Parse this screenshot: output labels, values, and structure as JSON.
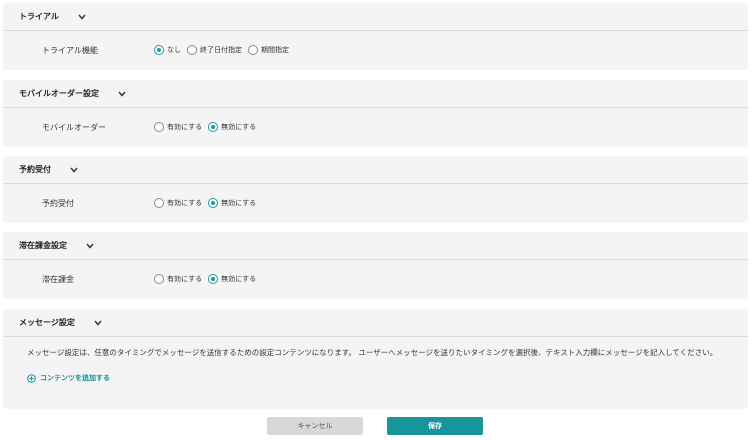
{
  "sections": [
    {
      "title": "トライアル",
      "field_label": "トライアル機能",
      "options": [
        {
          "label": "なし",
          "selected": true
        },
        {
          "label": "終了日付指定",
          "selected": false
        },
        {
          "label": "期間指定",
          "selected": false
        }
      ]
    },
    {
      "title": "モバイルオーダー設定",
      "field_label": "モバイルオーダー",
      "options": [
        {
          "label": "有効にする",
          "selected": false
        },
        {
          "label": "無効にする",
          "selected": true
        }
      ]
    },
    {
      "title": "予約受付",
      "field_label": "予約受付",
      "options": [
        {
          "label": "有効にする",
          "selected": false
        },
        {
          "label": "無効にする",
          "selected": true
        }
      ]
    },
    {
      "title": "滞在課金設定",
      "field_label": "滞在課金",
      "options": [
        {
          "label": "有効にする",
          "selected": false
        },
        {
          "label": "無効にする",
          "selected": true
        }
      ]
    }
  ],
  "message": {
    "title": "メッセージ設定",
    "description": "メッセージ設定は、任意のタイミングでメッセージを送信するための設定コンテンツになります。 ユーザーへメッセージを送りたいタイミングを選択後、テキスト入力欄にメッセージを記入してください。",
    "add_label": "コンテンツを追加する"
  },
  "buttons": {
    "cancel": "キャンセル",
    "save": "保存"
  },
  "colors": {
    "accent": "#16959c",
    "section_bg": "#f4f4f4",
    "cancel_bg": "#d8d8d8"
  }
}
